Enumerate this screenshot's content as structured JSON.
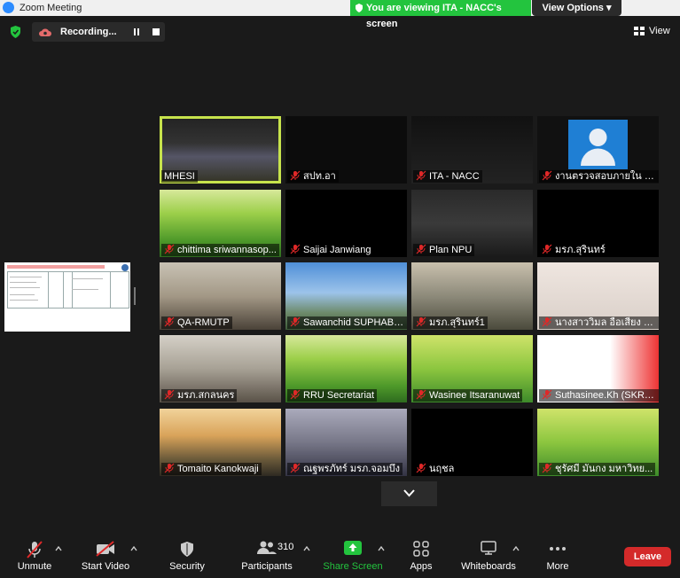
{
  "window": {
    "title": "Zoom Meeting"
  },
  "banner": {
    "text": "You are viewing ITA - NACC's screen"
  },
  "view_options": {
    "label": "View Options"
  },
  "recording": {
    "label": "Recording..."
  },
  "view_button": {
    "label": "View"
  },
  "participants_grid": [
    {
      "name": "MHESI",
      "muted": false,
      "active": true
    },
    {
      "name": "สปท.อา",
      "muted": true
    },
    {
      "name": "ITA - NACC",
      "muted": true
    },
    {
      "name": "งานตรวจสอบภายใน งา...",
      "muted": true
    },
    {
      "name": "chittima sriwannasop...",
      "muted": true
    },
    {
      "name": "Saijai Janwiang",
      "muted": true
    },
    {
      "name": "Plan NPU",
      "muted": true
    },
    {
      "name": "มรภ.สุรินทร์",
      "muted": true
    },
    {
      "name": "QA-RMUTP",
      "muted": true
    },
    {
      "name": "Sawanchid SUPHABW...",
      "muted": true
    },
    {
      "name": "มรภ.สุรินทร์1",
      "muted": true
    },
    {
      "name": "นางสาววิมล อือเสียง ม...",
      "muted": true
    },
    {
      "name": "มรภ.สกลนคร",
      "muted": true
    },
    {
      "name": "RRU Secretariat",
      "muted": true
    },
    {
      "name": "Wasinee Itsaranuwat",
      "muted": true
    },
    {
      "name": "Suthasinee.Kh (SKRU ...",
      "muted": true
    },
    {
      "name": "Tomaito Kanokwaji",
      "muted": true
    },
    {
      "name": "ณฐพรภัทร์ มรภ.จอมบึง",
      "muted": true
    },
    {
      "name": "นฤชล",
      "muted": true
    },
    {
      "name": "ชุรัศมี มันกง มหาวิทย...",
      "muted": true
    }
  ],
  "toolbar": {
    "unmute": "Unmute",
    "start_video": "Start Video",
    "security": "Security",
    "participants": "Participants",
    "participants_count": "310",
    "share_screen": "Share Screen",
    "apps": "Apps",
    "whiteboards": "Whiteboards",
    "more": "More",
    "leave": "Leave"
  },
  "colors": {
    "accent_green": "#23c43e",
    "active_border": "#c7e34c",
    "leave_red": "#d42a2a",
    "mute_red": "#e02828"
  }
}
